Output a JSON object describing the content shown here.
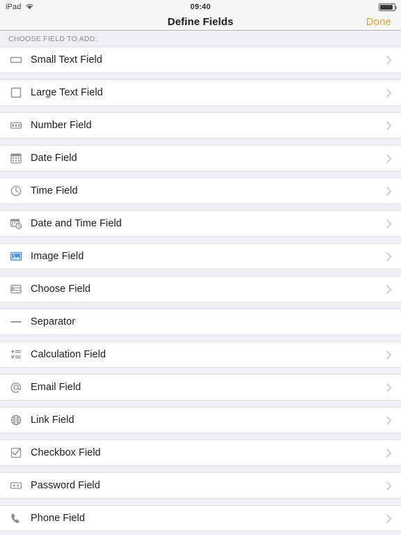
{
  "statusbar": {
    "carrier": "iPad",
    "wifi_icon": "wifi-icon",
    "time": "09:40",
    "battery_icon": "battery-icon",
    "battery_level": 88
  },
  "navbar": {
    "title": "Define Fields",
    "done_label": "Done",
    "done_color": "#f0a030"
  },
  "section": {
    "header": "CHOOSE FIELD TO ADD:"
  },
  "colors": {
    "list_background": "#efeff4",
    "row_background": "#ffffff",
    "separator": "#e3e3e6",
    "icon_gray": "#8e8e93",
    "icon_blue": "#4a90d9",
    "chevron": "#c8c8cc",
    "label_text": "#1c1c1e",
    "header_text": "#8a8a8f"
  },
  "rows": [
    {
      "label": "Small Text Field",
      "icon": "small-text-field-icon",
      "chevron": true
    },
    {
      "label": "Large Text Field",
      "icon": "large-text-field-icon",
      "chevron": true
    },
    {
      "label": "Number Field",
      "icon": "number-field-icon",
      "chevron": true
    },
    {
      "label": "Date Field",
      "icon": "calendar-icon",
      "chevron": true
    },
    {
      "label": "Time Field",
      "icon": "clock-icon",
      "chevron": true
    },
    {
      "label": "Date and Time Field",
      "icon": "date-time-icon",
      "chevron": true
    },
    {
      "label": "Image Field",
      "icon": "image-icon",
      "chevron": true
    },
    {
      "label": "Choose Field",
      "icon": "choose-list-icon",
      "chevron": true
    },
    {
      "label": "Separator",
      "icon": "separator-dash-icon",
      "chevron": false
    },
    {
      "label": "Calculation Field",
      "icon": "calculation-icon",
      "chevron": true
    },
    {
      "label": "Email Field",
      "icon": "at-sign-icon",
      "chevron": true
    },
    {
      "label": "Link Field",
      "icon": "globe-icon",
      "chevron": true
    },
    {
      "label": "Checkbox Field",
      "icon": "checkbox-icon",
      "chevron": true
    },
    {
      "label": "Password Field",
      "icon": "password-icon",
      "chevron": true
    },
    {
      "label": "Phone Field",
      "icon": "phone-icon",
      "chevron": true
    }
  ]
}
